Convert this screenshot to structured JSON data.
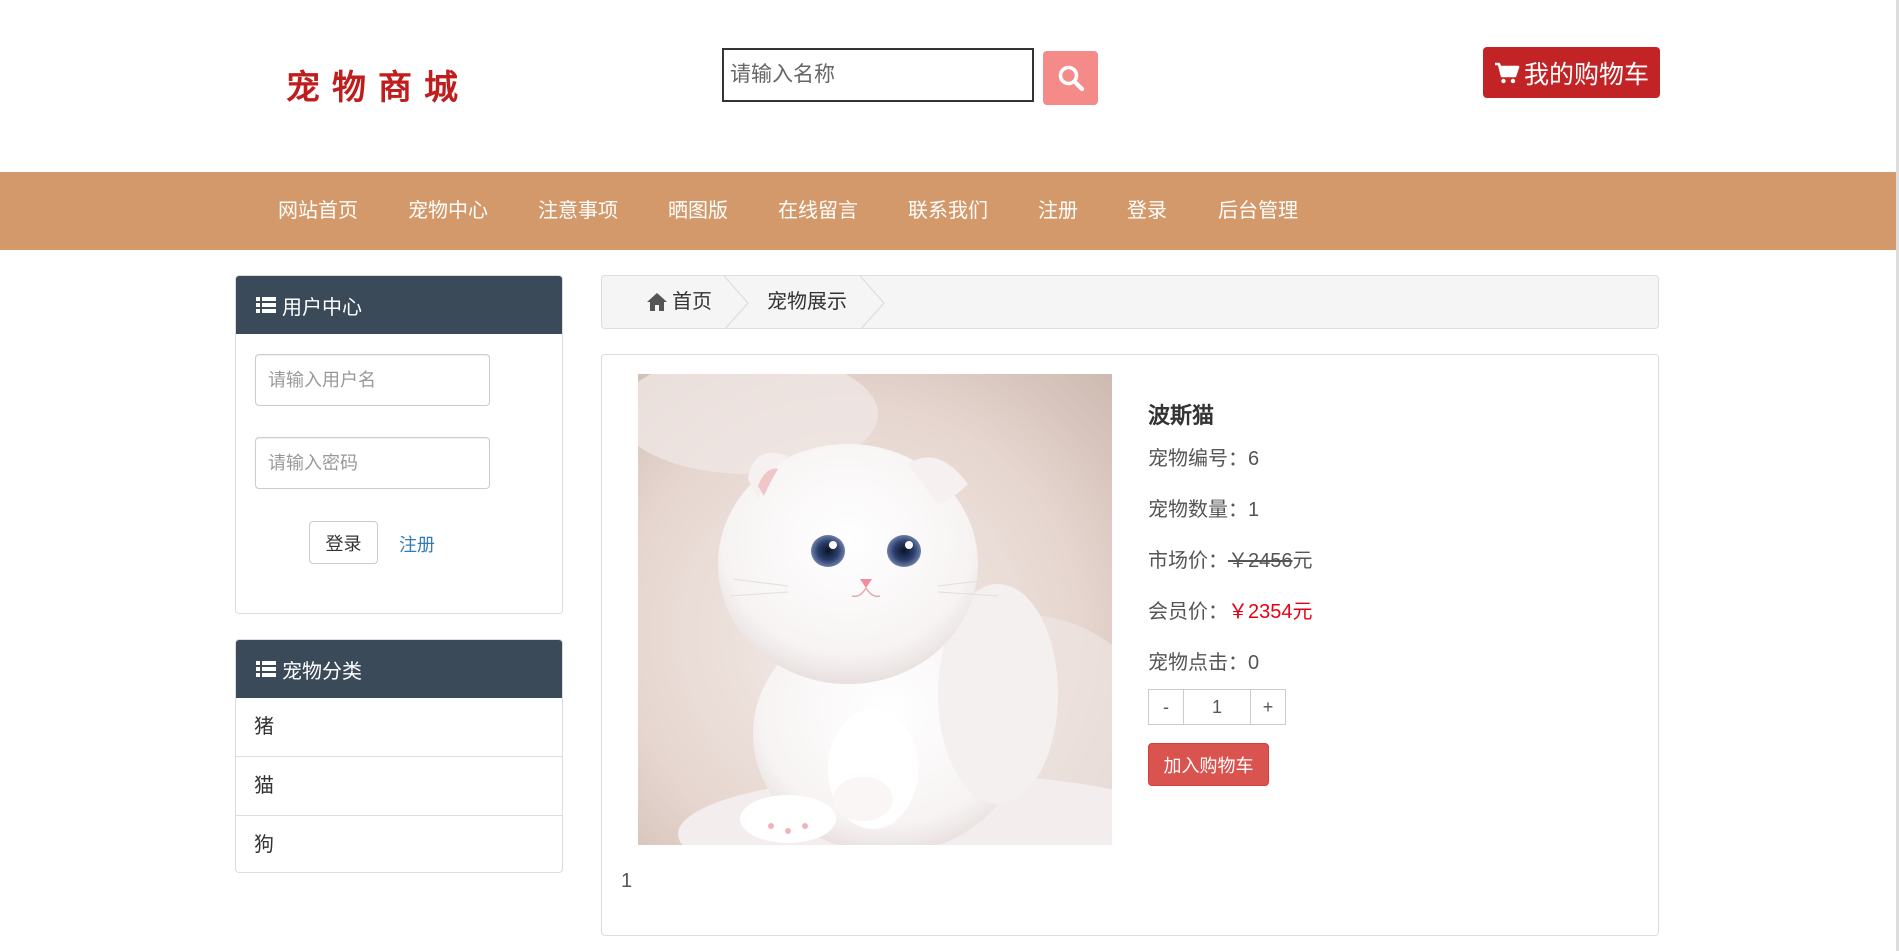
{
  "header": {
    "logo_text": "宠物商城",
    "search_placeholder": "请输入名称",
    "cart_label": "我的购物车"
  },
  "nav": {
    "items": [
      {
        "label": "网站首页"
      },
      {
        "label": "宠物中心"
      },
      {
        "label": "注意事项"
      },
      {
        "label": "晒图版"
      },
      {
        "label": "在线留言"
      },
      {
        "label": "联系我们"
      },
      {
        "label": "注册"
      },
      {
        "label": "登录"
      },
      {
        "label": "后台管理"
      }
    ]
  },
  "user_center": {
    "title": "用户中心",
    "username_placeholder": "请输入用户名",
    "password_placeholder": "请输入密码",
    "login_label": "登录",
    "register_label": "注册"
  },
  "categories": {
    "title": "宠物分类",
    "items": [
      "猪",
      "猫",
      "狗"
    ]
  },
  "breadcrumb": {
    "home": "首页",
    "current": "宠物展示"
  },
  "product": {
    "name": "波斯猫",
    "number_label": "宠物编号：",
    "number_value": "6",
    "quantity_label": "宠物数量：",
    "quantity_value": "1",
    "market_label": "市场价：",
    "market_value": "￥2456",
    "market_unit": "元",
    "member_label": "会员价：",
    "member_value": "￥2354元",
    "clicks_label": "宠物点击：",
    "clicks_value": "0",
    "qty_minus": "-",
    "qty_value": "1",
    "qty_plus": "+",
    "add_cart_label": "加入购物车"
  },
  "pagination": {
    "page": "1"
  },
  "colors": {
    "brand_red": "#c01d1d",
    "nav_bg": "#d4996a",
    "panel_head": "#3b4a59",
    "search_btn": "#f58b89",
    "cart_btn": "#c22426",
    "add_cart": "#d9534f",
    "price_red": "#e60012"
  },
  "icons": {
    "search": "search-icon",
    "cart": "cart-icon",
    "list": "list-icon",
    "home": "home-icon"
  }
}
